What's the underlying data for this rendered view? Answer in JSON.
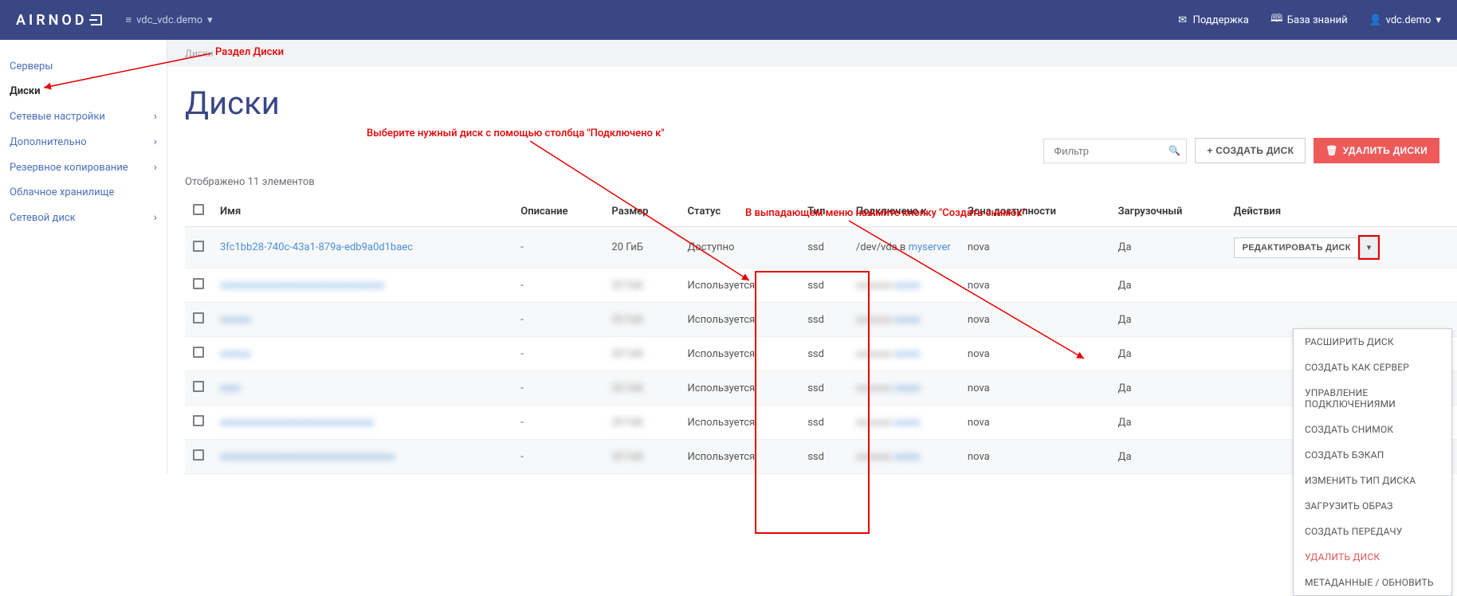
{
  "navbar": {
    "logo": "AIRNOD",
    "project_icon": "≡",
    "project": "vdc_vdc.demo",
    "support": "Поддержка",
    "kb": "База знаний",
    "user": "vdc.demo"
  },
  "sidebar": {
    "items": [
      {
        "label": "Серверы",
        "active": false,
        "chev": false
      },
      {
        "label": "Диски",
        "active": true,
        "chev": false
      },
      {
        "label": "Сетевые настройки",
        "active": false,
        "chev": true
      },
      {
        "label": "Дополнительно",
        "active": false,
        "chev": true
      },
      {
        "label": "Резервное копирование",
        "active": false,
        "chev": true
      },
      {
        "label": "Облачное хранилище",
        "active": false,
        "chev": false
      },
      {
        "label": "Сетевой диск",
        "active": false,
        "chev": true
      }
    ]
  },
  "breadcrumb": "Диски",
  "page_title": "Диски",
  "annotations": {
    "a1": "Раздел Диски",
    "a2": "Выберите нужный диск с помощью столбца \"Подключено к\"",
    "a3": "В выпадающем меню нажмите кнопку \"Создать снимок\""
  },
  "toolbar": {
    "filter_placeholder": "Фильтр",
    "create": "+ СОЗДАТЬ ДИСК",
    "delete": "УДАЛИТЬ ДИСКИ"
  },
  "count_label": "Отображено 11 элементов",
  "columns": {
    "name": "Имя",
    "desc": "Описание",
    "size": "Размер",
    "status": "Статус",
    "type": "Тип",
    "attached": "Подключено к",
    "zone": "Зона доступности",
    "boot": "Загрузочный",
    "actions": "Действия"
  },
  "rows": [
    {
      "name": "3fc1bb28-740c-43a1-879a-edb9a0d1baec",
      "desc": "-",
      "size": "20 ГиБ",
      "status": "Доступно",
      "type": "ssd",
      "attached_prefix": "/dev/vda в ",
      "attached_link": "myserver",
      "zone": "nova",
      "boot": "Да",
      "edit": "РЕДАКТИРОВАТЬ ДИСК",
      "blur": false
    },
    {
      "name": "xxxxxxxxxxxxxxxxxxxxxxxxxxxxxxxx",
      "desc": "-",
      "size": "20 ГиБ",
      "status": "Используется",
      "type": "ssd",
      "attached_prefix": "xxxxxxx ",
      "attached_link": "xxxxx",
      "zone": "nova",
      "boot": "Да",
      "blur": true
    },
    {
      "name": "xxxxxx",
      "desc": "-",
      "size": "20 ГиБ",
      "status": "Используется",
      "type": "ssd",
      "attached_prefix": "xxxxxxx ",
      "attached_link": "xxxxx",
      "zone": "nova",
      "boot": "Да",
      "blur": true
    },
    {
      "name": "xxxxxx",
      "desc": "-",
      "size": "20 ГиБ",
      "status": "Используется",
      "type": "ssd",
      "attached_prefix": "xxxxxxx ",
      "attached_link": "xxxxx",
      "zone": "nova",
      "boot": "Да",
      "blur": true
    },
    {
      "name": "xxxx",
      "desc": "-",
      "size": "20 ГиБ",
      "status": "Используется",
      "type": "ssd",
      "attached_prefix": "xxxxxxx ",
      "attached_link": "xxxxx",
      "zone": "nova",
      "boot": "Да",
      "blur": true
    },
    {
      "name": "xxxxxxxxxxxxxxxxxxxxxxxxxxxxxx",
      "desc": "-",
      "size": "20 ГиБ",
      "status": "Используется",
      "type": "ssd",
      "attached_prefix": "xxxxxxx ",
      "attached_link": "xxxxx",
      "zone": "nova",
      "boot": "Да",
      "blur": true
    },
    {
      "name": "xxxxxxxxxxxxxxxxxxxxxxxxxxxxxxxxxx",
      "desc": "-",
      "size": "20 ГиБ",
      "status": "Используется",
      "type": "ssd",
      "attached_prefix": "xxxxxxx ",
      "attached_link": "xxxxx",
      "zone": "nova",
      "boot": "Да",
      "blur": true
    }
  ],
  "dropdown": [
    {
      "label": "РАСШИРИТЬ ДИСК"
    },
    {
      "label": "СОЗДАТЬ КАК СЕРВЕР"
    },
    {
      "label": "УПРАВЛЕНИЕ ПОДКЛЮЧЕНИЯМИ"
    },
    {
      "label": "СОЗДАТЬ СНИМОК"
    },
    {
      "label": "СОЗДАТЬ БЭКАП"
    },
    {
      "label": "ИЗМЕНИТЬ ТИП ДИСКА"
    },
    {
      "label": "ЗАГРУЗИТЬ ОБРАЗ"
    },
    {
      "label": "СОЗДАТЬ ПЕРЕДАЧУ"
    },
    {
      "label": "УДАЛИТЬ ДИСК",
      "danger": true
    },
    {
      "label": "МЕТАДАННЫЕ / ОБНОВИТЬ"
    }
  ]
}
